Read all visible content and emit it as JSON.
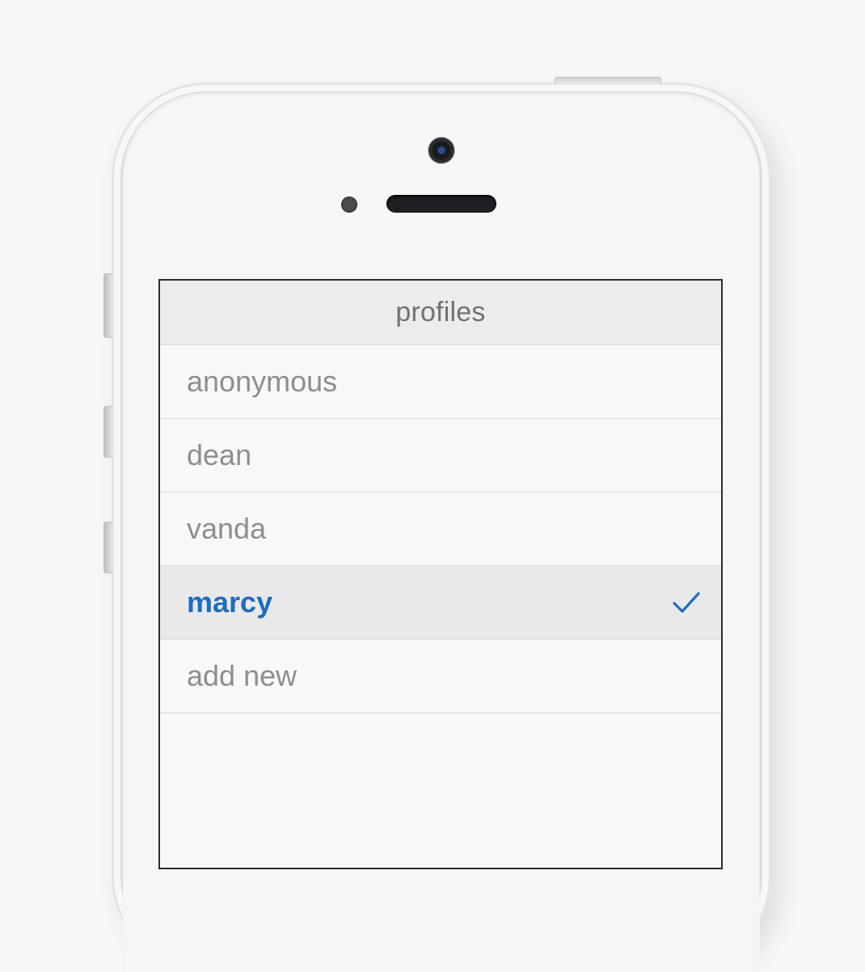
{
  "screen": {
    "title": "profiles"
  },
  "profiles": {
    "items": [
      {
        "label": "anonymous",
        "selected": false
      },
      {
        "label": "dean",
        "selected": false
      },
      {
        "label": "vanda",
        "selected": false
      },
      {
        "label": "marcy",
        "selected": true,
        "icon": "checkmark-icon"
      },
      {
        "label": "add new",
        "selected": false
      }
    ]
  },
  "colors": {
    "accent": "#1f6dbf",
    "item_text": "#8c8e91",
    "title_text": "#707275",
    "selected_row_bg": "#e9e9ec"
  }
}
